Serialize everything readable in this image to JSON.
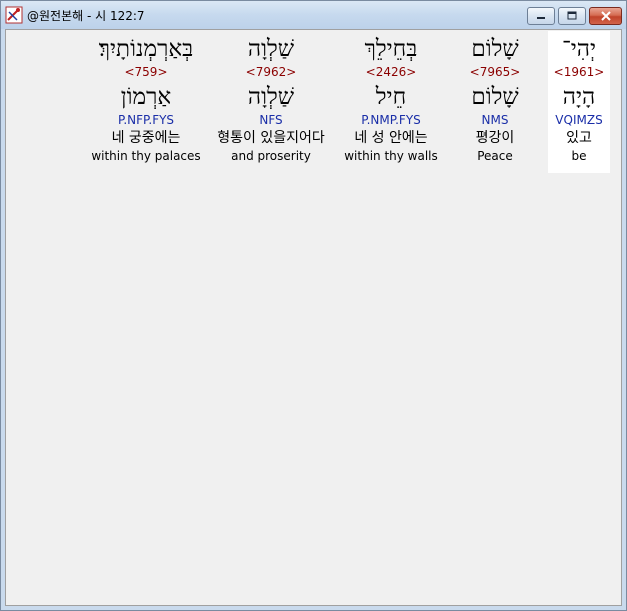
{
  "window": {
    "title": "@원전본해 - 시 122:7"
  },
  "words": [
    {
      "hebrew": "יְהִי־",
      "strong": "<1961>",
      "root": "הָיָה",
      "morph": "VQIMZS",
      "korean": "있고",
      "english": "be",
      "highlighted": true
    },
    {
      "hebrew": "שָׁלוֹם",
      "strong": "<7965>",
      "root": "שָׁלוֹם",
      "morph": "NMS",
      "korean": "평강이",
      "english": "Peace",
      "highlighted": false
    },
    {
      "hebrew": "בְּחֵילֵךְ",
      "strong": "<2426>",
      "root": "חֵיל",
      "morph": "P.NMP.FYS",
      "korean": "네 성 안에는",
      "english": "within thy walls",
      "highlighted": false
    },
    {
      "hebrew": "שַׁלְוָה",
      "strong": "<7962>",
      "root": "שַׁלְוָה",
      "morph": "NFS",
      "korean": "형통이 있을지어다",
      "english": "and proserity",
      "highlighted": false
    },
    {
      "hebrew": "בְּאַרְמְנוֹתָיִךְ׃",
      "strong": "<759>",
      "root": "אַרְמוֹן",
      "morph": "P.NFP.FYS",
      "korean": "네 궁중에는",
      "english": "within thy palaces",
      "highlighted": false
    }
  ]
}
